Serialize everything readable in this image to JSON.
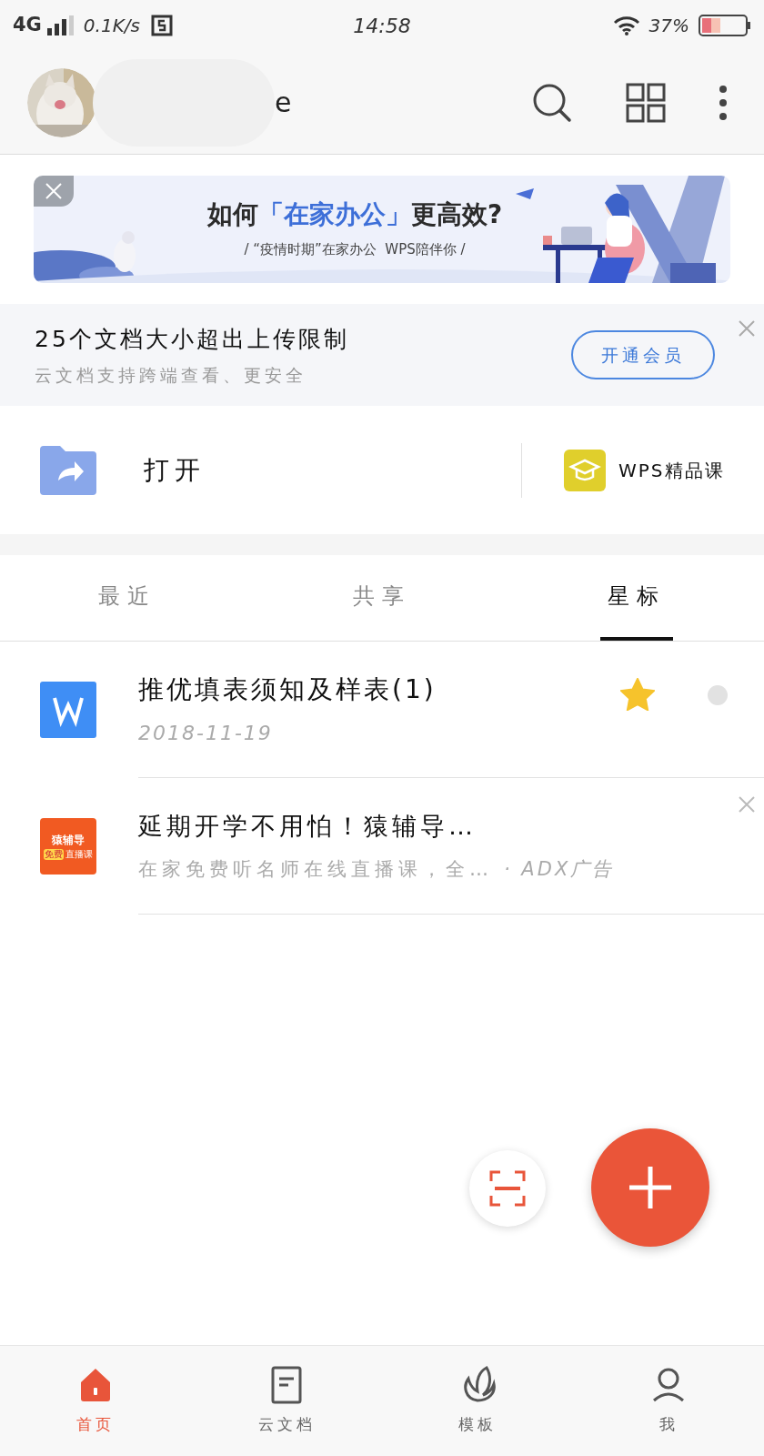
{
  "status_bar": {
    "network": "4G",
    "speed": "0.1K/s",
    "time": "14:58",
    "battery": "37%"
  },
  "header": {
    "name_visible": "e"
  },
  "banner": {
    "title_before": "如何",
    "title_highlight": "「在家办公」",
    "title_after": "更高效?",
    "subtitle": "/ “疫情时期”在家办公  WPS陪伴你 /"
  },
  "notice": {
    "title": "25个文档大小超出上传限制",
    "subtitle": "云文档支持跨端查看、更安全",
    "button": "开通会员"
  },
  "quick_actions": [
    {
      "kind": "open",
      "label": "打开"
    },
    {
      "kind": "course",
      "label": "WPS精品课"
    }
  ],
  "tabs": [
    {
      "label": "最近",
      "selected": false
    },
    {
      "label": "共享",
      "selected": false
    },
    {
      "label": "星标",
      "selected": true
    }
  ],
  "files": [
    {
      "kind": "document",
      "name": "推优填表须知及样表(1)",
      "date": "2018-11-19",
      "starred": true
    },
    {
      "kind": "ad",
      "icon_title": "猿辅导",
      "icon_badge": "免费",
      "icon_caption": "直播课",
      "name": "延期开学不用怕！猿辅导…",
      "description": "在家免费听名师在线直播课，全…",
      "source": "· ADX广告"
    }
  ],
  "bottom_nav": [
    {
      "label": "首页",
      "selected": true
    },
    {
      "label": "云文档",
      "selected": false
    },
    {
      "label": "模板",
      "selected": false
    },
    {
      "label": "我",
      "selected": false
    }
  ]
}
